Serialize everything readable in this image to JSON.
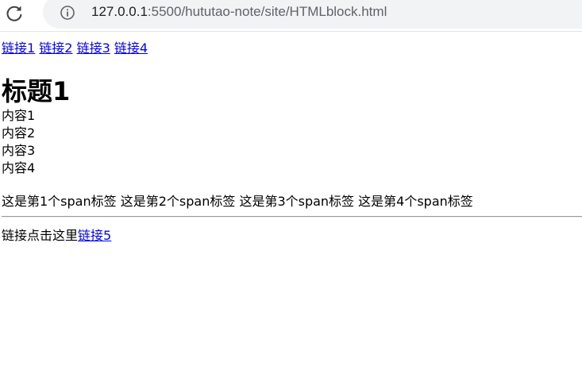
{
  "browser": {
    "url_host": "127.0.0.1",
    "url_rest": ":5500/hututao-note/site/HTMLblock.html",
    "reload_icon": "reload-icon",
    "info_icon": "info-icon"
  },
  "nav": {
    "links": [
      "链接1",
      "链接2",
      "链接3",
      "链接4"
    ]
  },
  "main": {
    "heading": "标题1",
    "paragraphs": [
      "内容1",
      "内容2",
      "内容3",
      "内容4"
    ],
    "spans": [
      "这是第1个span标签",
      "这是第2个span标签",
      "这是第3个span标签",
      "这是第4个span标签"
    ]
  },
  "footer": {
    "prefix": "链接点击这里",
    "link": "链接5"
  },
  "colors": {
    "link": "#0000ee",
    "text": "#000000",
    "rule": "#999999",
    "omnibox": "#f1f3f4"
  }
}
